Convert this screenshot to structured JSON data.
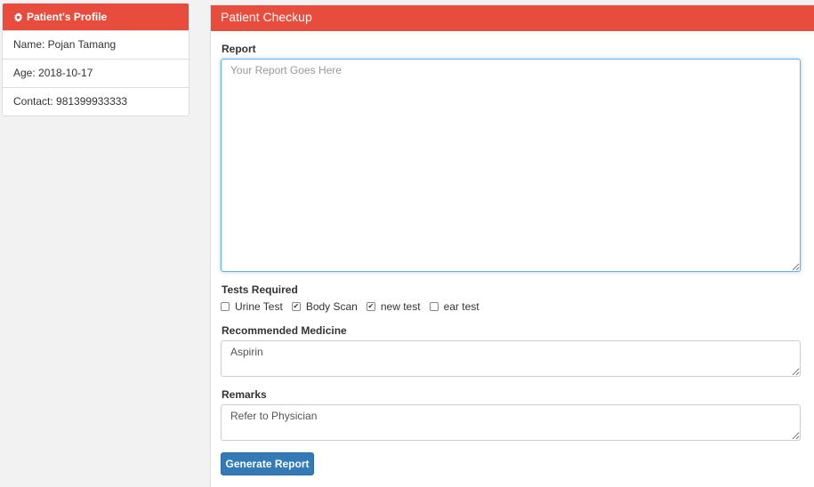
{
  "profile": {
    "title": "Patient's Profile",
    "name": "Name: Pojan Tamang",
    "age": "Age: 2018-10-17",
    "contact": "Contact: 981399933333"
  },
  "checkup": {
    "title": "Patient Checkup",
    "report_label": "Report",
    "report_placeholder": "Your Report Goes Here",
    "tests_label": "Tests Required",
    "tests": [
      {
        "label": "Urine Test",
        "checked": false
      },
      {
        "label": "Body Scan",
        "checked": true
      },
      {
        "label": "new test",
        "checked": true
      },
      {
        "label": "ear test",
        "checked": false
      }
    ],
    "medicine_label": "Recommended Medicine",
    "medicine_value": "Aspirin",
    "remarks_label": "Remarks",
    "remarks_value": "Refer to Physician",
    "generate_button": "Generate Report"
  },
  "colors": {
    "header_red": "#e74c3c",
    "button_blue": "#337ab7"
  }
}
